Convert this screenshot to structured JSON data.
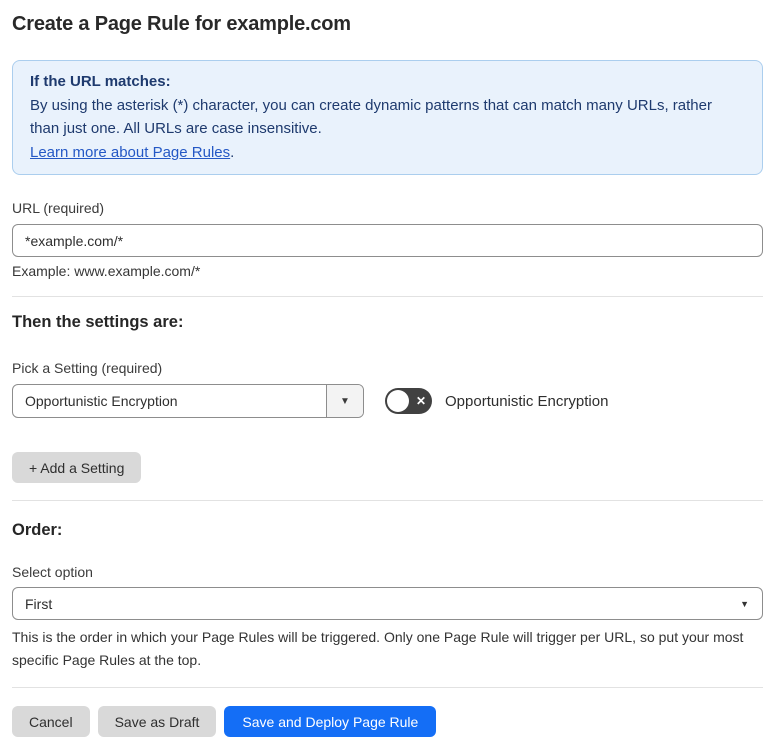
{
  "page": {
    "title": "Create a Page Rule for example.com"
  },
  "info_box": {
    "heading": "If the URL matches:",
    "body": "By using the asterisk (*) character, you can create dynamic patterns that can match many URLs, rather than just one. All URLs are case insensitive.",
    "link_label": "Learn more about Page Rules",
    "link_suffix": "."
  },
  "url_field": {
    "label": "URL (required)",
    "value": "*example.com/*",
    "example": "Example: www.example.com/*"
  },
  "settings_section": {
    "heading": "Then the settings are:",
    "picker_label": "Pick a Setting (required)",
    "selected_setting": "Opportunistic Encryption",
    "toggle": {
      "state": "off",
      "off_glyph": "✕",
      "label": "Opportunistic Encryption"
    },
    "add_button_label": "+ Add a Setting"
  },
  "order_section": {
    "heading": "Order:",
    "select_label": "Select option",
    "selected_option": "First",
    "help_text": "This is the order in which your Page Rules will be triggered. Only one Page Rule will trigger per URL, so put your most specific Page Rules at the top."
  },
  "footer": {
    "cancel_label": "Cancel",
    "save_draft_label": "Save as Draft",
    "save_deploy_label": "Save and Deploy Page Rule"
  },
  "icons": {
    "dropdown_caret": "▼"
  },
  "colors": {
    "info_box_bg": "#e9f2fc",
    "info_box_border": "#abceee",
    "info_text": "#1e3a6e",
    "link_blue": "#2458c5",
    "toggle_off_bg": "#414141",
    "primary_button_bg": "#146ef6",
    "secondary_button_bg": "#d9d9d9",
    "input_border": "#8d8d8d"
  }
}
